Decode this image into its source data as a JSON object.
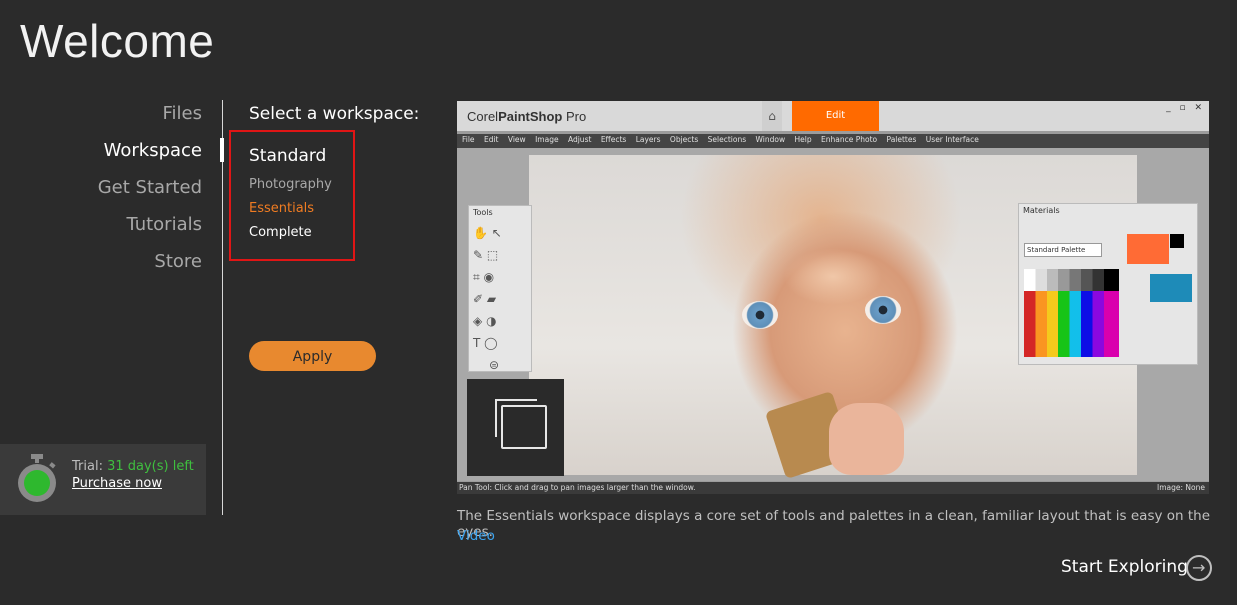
{
  "header": {
    "title": "Welcome"
  },
  "nav": {
    "items": [
      {
        "label": "Files"
      },
      {
        "label": "Workspace",
        "active": true
      },
      {
        "label": "Get Started"
      },
      {
        "label": "Tutorials"
      },
      {
        "label": "Store"
      }
    ]
  },
  "trial": {
    "label": "Trial:",
    "days": "31 day(s) left",
    "purchase_label": "Purchase now",
    "colors": {
      "days": "#3fbf3f",
      "icon_fill": "#2eb82e"
    }
  },
  "workspace": {
    "select_label": "Select a workspace:",
    "options": [
      {
        "label": "Standard"
      },
      {
        "label": "Photography"
      },
      {
        "label": "Essentials",
        "selected": true
      },
      {
        "label": "Complete"
      }
    ],
    "apply_label": "Apply",
    "colors": {
      "accent": "#e8892f",
      "selected": "#f07c22",
      "highlight_box": "#e01515"
    }
  },
  "preview": {
    "brand_prefix": "Corel",
    "brand_name": "PaintShop",
    "brand_suffix": "Pro",
    "home_icon": "home-icon",
    "edit_tab": "Edit",
    "window_controls": "_ ▫ ✕",
    "menu": [
      "File",
      "Edit",
      "View",
      "Image",
      "Adjust",
      "Effects",
      "Layers",
      "Objects",
      "Selections",
      "Window",
      "Help",
      "Enhance Photo",
      "Palettes",
      "User Interface"
    ],
    "tools_title": "Tools",
    "materials_title": "Materials",
    "palette_select": "Standard Palette",
    "status_left": "Pan Tool: Click and drag to pan images larger than the window.",
    "status_right": "Image: None"
  },
  "description": {
    "text": "The Essentials workspace displays a core set of tools and palettes in a clean, familiar layout that is easy on the eyes.",
    "video_label": "Video"
  },
  "footer": {
    "start_label": "Start Exploring"
  }
}
